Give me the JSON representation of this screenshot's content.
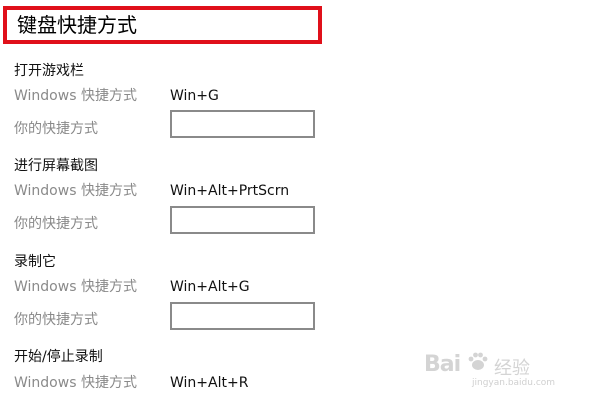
{
  "header": {
    "title": "键盘快捷方式"
  },
  "labels": {
    "windows_shortcut": "Windows 快捷方式",
    "your_shortcut": "你的快捷方式"
  },
  "sections": [
    {
      "title": "打开游戏栏",
      "windows_value": "Win+G",
      "your_value": ""
    },
    {
      "title": "进行屏幕截图",
      "windows_value": "Win+Alt+PrtScrn",
      "your_value": ""
    },
    {
      "title": "录制它",
      "windows_value": "Win+Alt+G",
      "your_value": ""
    },
    {
      "title": "开始/停止录制",
      "windows_value": "Win+Alt+R"
    }
  ],
  "watermark": {
    "brand_part1": "Bai",
    "brand_part2": "经验",
    "url": "jingyan.baidu.com"
  },
  "colors": {
    "title_border": "#e0101a",
    "label_gray": "#8a8a8a"
  }
}
